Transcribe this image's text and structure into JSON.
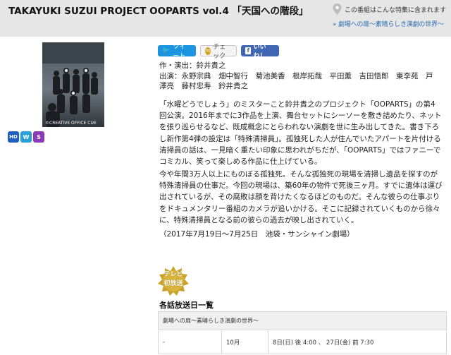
{
  "header": {
    "title": "TAKAYUKI SUZUI PROJECT OOPARTS vol.4 「天国への階段」",
    "feature_heading": "この番組はこんな特集に含まれます",
    "feature_link": "» 劇場への扉〜素晴らしき演劇の世界〜"
  },
  "poster": {
    "credit": "©CREATIVE OFFICE CUE"
  },
  "badges": [
    "HD",
    "W",
    "S"
  ],
  "social": {
    "tweet": "ツイート",
    "check": "チェック",
    "like": "いいね！"
  },
  "credits": {
    "line1": "作・演出：鈴井貴之",
    "line2": "出演：永野宗典　畑中智行　菊池美香　根岸拓哉　平田薫　吉田悟郎　東李苑　戸澤亮　藤村忠寿　鈴井貴之"
  },
  "description": {
    "p1": "「水曜どうでしょう」のミスターこと鈴井貴之のプロジェクト「OOPARTS」の第4回公演。2016年までに3作品を上演、舞台セットにシーソーを敷き詰めたり、ネットを張り巡らせるなど、既成概念にとらわれない演劇を世に生み出してきた。書き下ろし新作第4弾の設定は「特殊清掃員」。孤独死した人が住んでいたアパートを片付ける清掃員の話は、一見暗く重たい印象に思われがちだが、「OOPARTS」ではファニーでコミカル、笑って楽しめる作品に仕上げている。",
    "p2": "今や年間3万人以上にものぼる孤独死。そんな孤独死の現場を清掃し遺品を探すのが特殊清掃員の仕事だ。今回の現場は、築60年の物件で死後三ヶ月。すでに遺体は運び出されているが、その腐敗は顔を背けたくなるほどのものだ。そんな彼らの仕事ぶりをドキュメンタリー番組のカメラが追いかける。そこに記録されていくものから徐々に、特殊清掃員となる前の彼らの過去が映し出されていく。",
    "p3": "（2017年7月19日〜7月25日　池袋・サンシャイン劇場）"
  },
  "tv_badge": {
    "line1": "テレビ",
    "line2": "初放送"
  },
  "schedule": {
    "title": "各話放送日一覧",
    "header_label": "劇場への扉〜素晴らしき演劇の世界〜",
    "rows": [
      {
        "episode": "-",
        "month": "10月",
        "times": "8日(日) 後 4:00 、 27日(金) 前 7:30"
      }
    ]
  }
}
